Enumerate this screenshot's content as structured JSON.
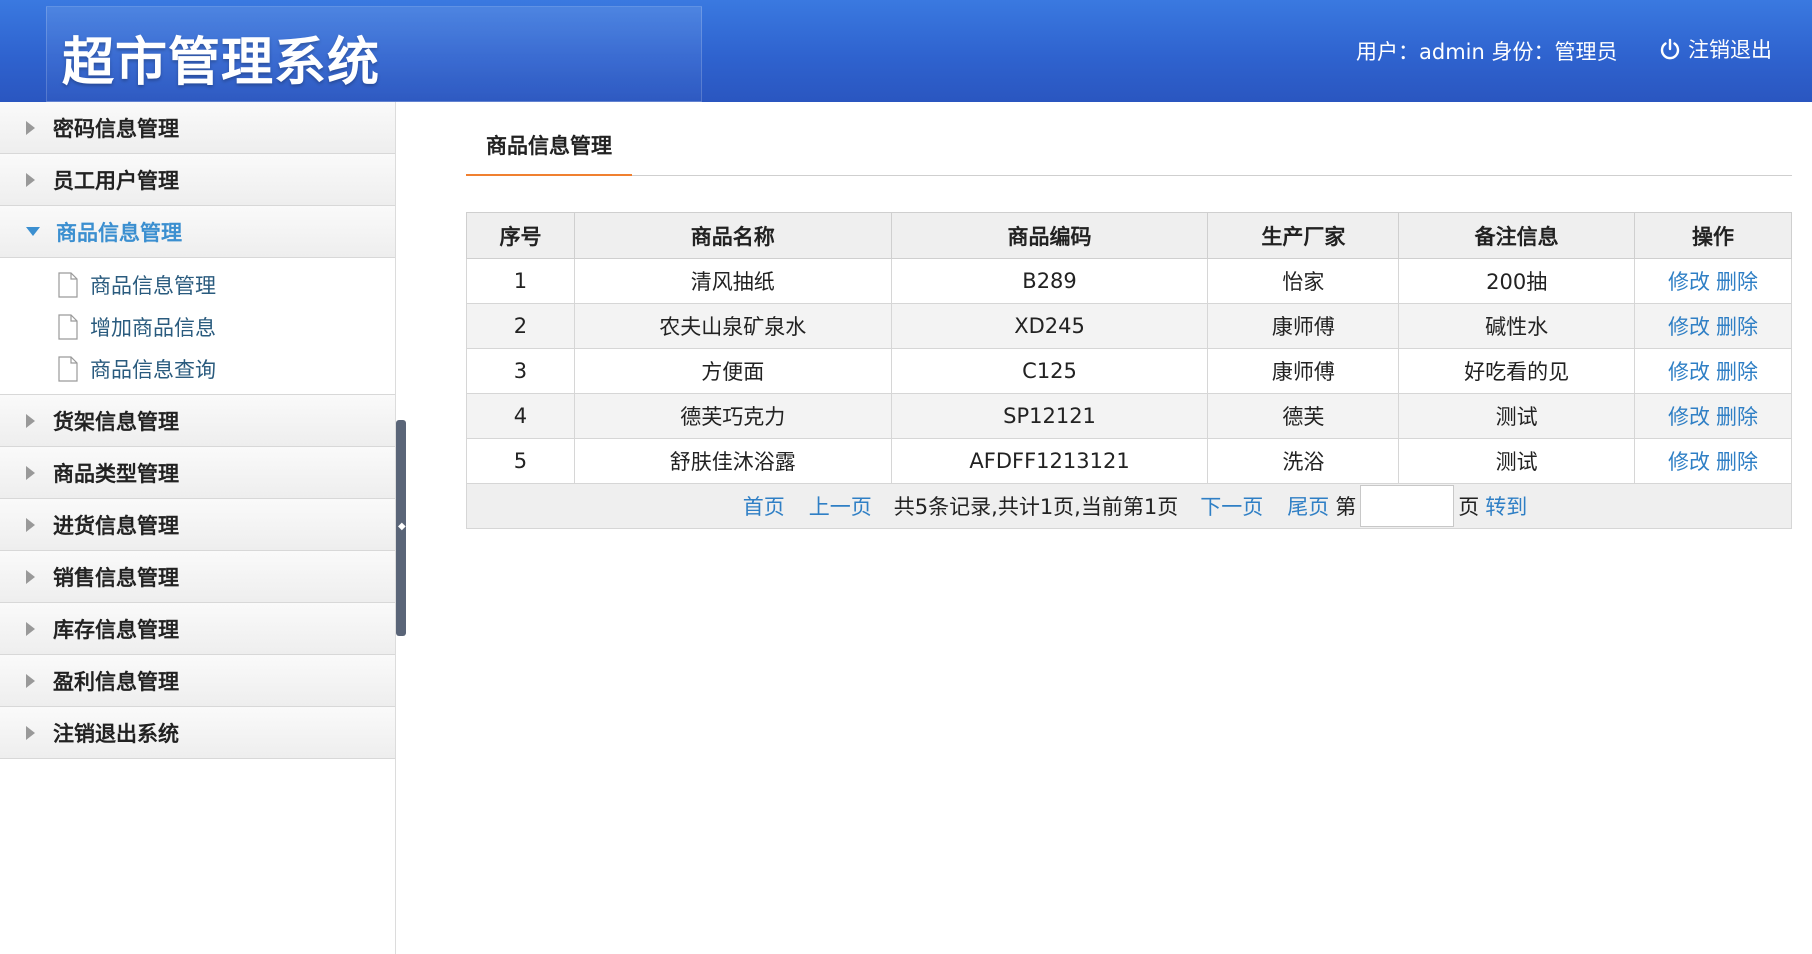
{
  "header": {
    "title": "超市管理系统",
    "user_info": "用户：admin 身份：管理员",
    "logout_label": "注销退出"
  },
  "sidebar": {
    "items": [
      {
        "label": "密码信息管理"
      },
      {
        "label": "员工用户管理"
      },
      {
        "label": "商品信息管理",
        "open": true,
        "children": [
          {
            "label": "商品信息管理"
          },
          {
            "label": "增加商品信息"
          },
          {
            "label": "商品信息查询"
          }
        ]
      },
      {
        "label": "货架信息管理"
      },
      {
        "label": "商品类型管理"
      },
      {
        "label": "进货信息管理"
      },
      {
        "label": "销售信息管理"
      },
      {
        "label": "库存信息管理"
      },
      {
        "label": "盈利信息管理"
      },
      {
        "label": "注销退出系统"
      }
    ]
  },
  "main": {
    "tab_label": "商品信息管理",
    "table": {
      "columns": [
        "序号",
        "商品名称",
        "商品编码",
        "生产厂家",
        "备注信息",
        "操作"
      ],
      "rows": [
        [
          "1",
          "清风抽纸",
          "B289",
          "怡家",
          "200抽"
        ],
        [
          "2",
          "农夫山泉矿泉水",
          "XD245",
          "康师傅",
          "碱性水"
        ],
        [
          "3",
          "方便面",
          "C125",
          "康师傅",
          "好吃看的见"
        ],
        [
          "4",
          "德芙巧克力",
          "SP12121",
          "德芙",
          "测试"
        ],
        [
          "5",
          "舒肤佳沐浴露",
          "AFDFF1213121",
          "洗浴",
          "测试"
        ]
      ],
      "edit_label": "修改",
      "delete_label": "删除"
    },
    "pager": {
      "first": "首页",
      "prev": "上一页",
      "summary": "共5条记录,共计1页,当前第1页",
      "next": "下一页",
      "last": "尾页",
      "page_prefix": "第",
      "page_input_value": "",
      "page_suffix": "页",
      "goto": "转到"
    }
  },
  "colors": {
    "header_blue": "#2f63cf",
    "link_blue": "#2f7fc5",
    "active_menu": "#3b8fd0",
    "tab_underline": "#f08030"
  }
}
